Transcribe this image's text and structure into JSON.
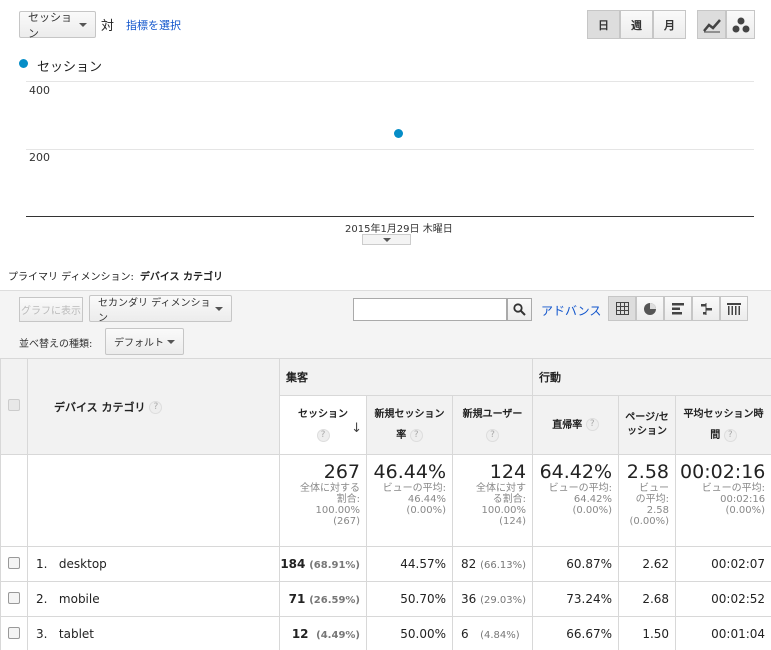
{
  "top_controls": {
    "metric_select": "セッション",
    "versus": "対",
    "select_metric_link": "指標を選択",
    "period_buttons": [
      "日",
      "週",
      "月"
    ]
  },
  "chart_data": {
    "type": "scatter",
    "series": [
      {
        "name": "セッション",
        "values": [
          267
        ]
      }
    ],
    "x": [
      "2015年1月29日 木曜日"
    ],
    "y_ticks": [
      400,
      200
    ],
    "ylim": [
      0,
      500
    ],
    "grid": true,
    "legend": "top-left",
    "color": "#058dc7"
  },
  "dimension": {
    "label": "プライマリ ディメンション:",
    "value": "デバイス カテゴリ"
  },
  "toolbar": {
    "chart_button": "グラフに表示",
    "secondary_dimension": "セカンダリ ディメンション",
    "search_placeholder": "",
    "advanced_link": "アドバンス",
    "sort_label": "並べ替えの種類:",
    "sort_value": "デフォルト"
  },
  "table": {
    "dim_header": "デバイス カテゴリ",
    "group_acq": "集客",
    "group_beh": "行動",
    "columns": [
      "セッション",
      "新規セッション率",
      "新規ユーザー",
      "直帰率",
      "ページ/セッション",
      "平均セッション時間"
    ],
    "totals": [
      {
        "value": "267",
        "sub": [
          "全体に対する",
          "割合:",
          "100.00%",
          "(267)"
        ]
      },
      {
        "value": "46.44%",
        "sub": [
          "ビューの平均:",
          "46.44%",
          "(0.00%)"
        ]
      },
      {
        "value": "124",
        "sub": [
          "全体に対す",
          "る割合:",
          "100.00%",
          "(124)"
        ]
      },
      {
        "value": "64.42%",
        "sub": [
          "ビューの平均:",
          "64.42%",
          "(0.00%)"
        ]
      },
      {
        "value": "2.58",
        "sub": [
          "ビュー",
          "の平均:",
          "2.58",
          "(0.00%)"
        ]
      },
      {
        "value": "00:02:16",
        "sub": [
          "ビューの平均:",
          "00:02:16",
          "(0.00%)"
        ]
      }
    ],
    "rows": [
      {
        "index": "1.",
        "name": "desktop",
        "sessions": "184",
        "sessions_pct": "(68.91%)",
        "new_rate": "44.57%",
        "new_users": "82",
        "new_users_pct": "(66.13%)",
        "bounce": "60.87%",
        "pages": "2.62",
        "duration": "00:02:07"
      },
      {
        "index": "2.",
        "name": "mobile",
        "sessions": "71",
        "sessions_pct": "(26.59%)",
        "new_rate": "50.70%",
        "new_users": "36",
        "new_users_pct": "(29.03%)",
        "bounce": "73.24%",
        "pages": "2.68",
        "duration": "00:02:52"
      },
      {
        "index": "3.",
        "name": "tablet",
        "sessions": "12",
        "sessions_pct": "(4.49%)",
        "new_rate": "50.00%",
        "new_users": "6",
        "new_users_pct": "(4.84%)",
        "bounce": "66.67%",
        "pages": "1.50",
        "duration": "00:01:04"
      }
    ]
  }
}
